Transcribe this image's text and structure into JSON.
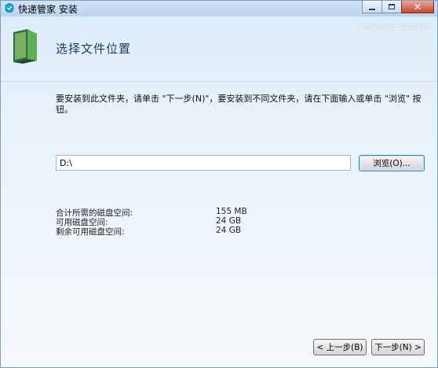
{
  "window": {
    "title": "快递管家 安装",
    "brand": "Advanced Installer"
  },
  "header": {
    "title": "选择文件位置"
  },
  "instruction": "要安装到此文件夹，请单击 \"下一步(N)\"，要安装到不同文件夹，请在下面输入或单击 \"浏览\" 按钮。",
  "path": {
    "value": "D:\\"
  },
  "buttons": {
    "browse": "浏览(O)...",
    "back": "< 上一步(B)",
    "next": "下一步(N) >"
  },
  "disk_space": [
    {
      "label": "合计所需的磁盘空间:",
      "value": "155 MB"
    },
    {
      "label": "可用磁盘空间:",
      "value": "24 GB"
    },
    {
      "label": "剩余可用磁盘空间:",
      "value": "24 GB"
    }
  ],
  "colors": {
    "accent": "#1b3a66",
    "background": "#eaf3fb"
  }
}
